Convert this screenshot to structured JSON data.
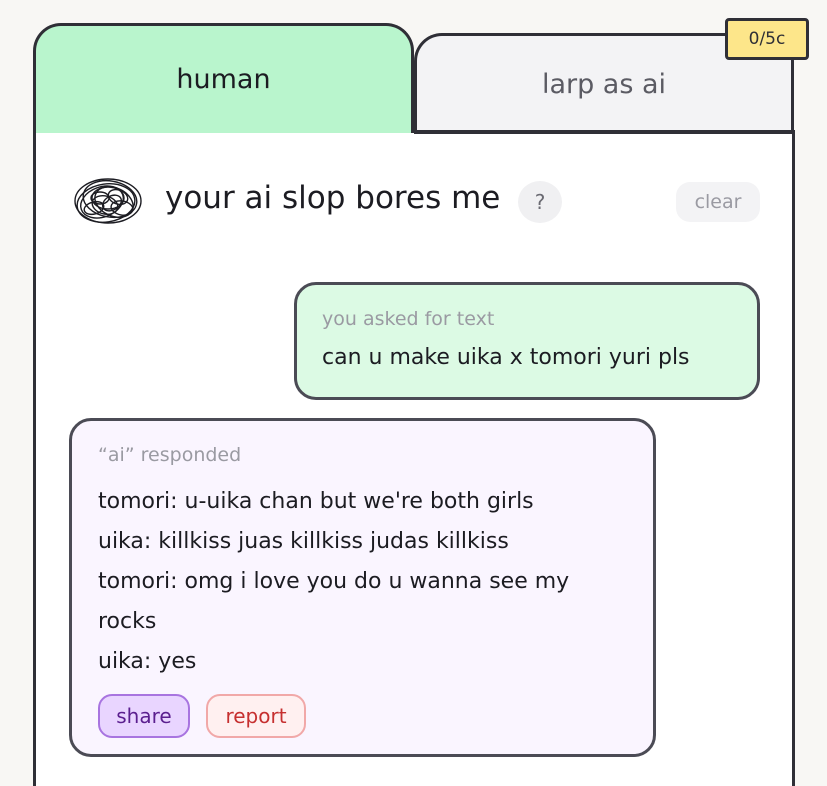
{
  "tabs": {
    "human": "human",
    "larp": "larp as ai"
  },
  "credits_badge": "0/5c",
  "header": {
    "title": "your ai slop bores me",
    "help_label": "?",
    "clear_label": "clear"
  },
  "user_message": {
    "label": "you asked for text",
    "text": "can u make uika x tomori yuri pls"
  },
  "ai_message": {
    "label": "“ai” responded",
    "lines": [
      "tomori: u-uika chan but we're both girls",
      "uika: killkiss juas killkiss judas killkiss",
      "tomori: omg i love you do u wanna see my",
      "rocks",
      "uika: yes"
    ]
  },
  "actions": {
    "share_label": "share",
    "report_label": "report"
  },
  "colors": {
    "human_tab": "#b9f5cd",
    "larp_tab": "#f3f3f5",
    "badge": "#fde68a",
    "user_bubble": "#dcfae4",
    "ai_bubble": "#faf5ff",
    "share": "#e9d5ff",
    "report": "#fff0f0"
  }
}
